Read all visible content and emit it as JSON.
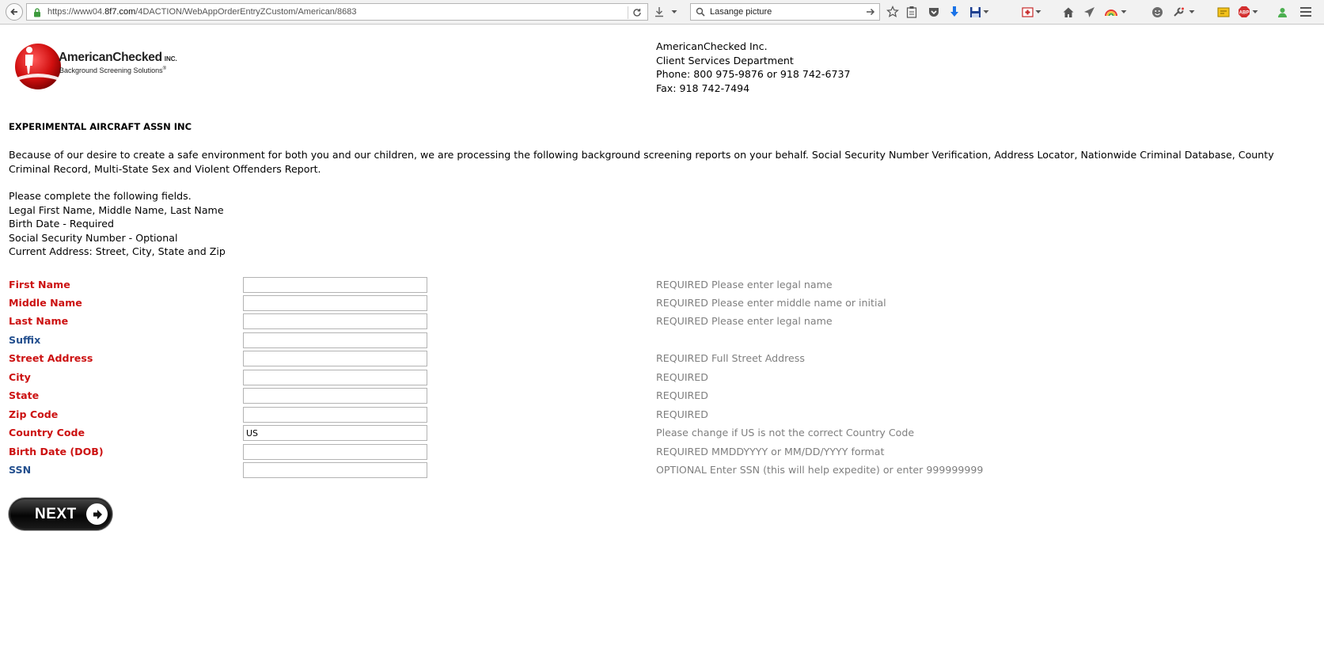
{
  "browser": {
    "url_prefix": "https://www04.",
    "url_host": "8f7.com",
    "url_path": "/4DACTION/WebAppOrderEntryZCustom/American/8683",
    "search_value": "Lasange picture",
    "colors": {
      "chrome_bg": "#f2f2f2",
      "download_arrow": "#1a73e8",
      "adblock": "#d32f2f"
    }
  },
  "logo": {
    "brand": "AmericanChecked",
    "brand_suffix": "INC.",
    "tagline": "Background Screening Solutions",
    "tagline_mark": "®"
  },
  "company": {
    "name": "AmericanChecked Inc.",
    "department": "Client Services Department",
    "phone": "Phone: 800 975-9876 or 918 742-6737",
    "fax": "Fax: 918 742-7494"
  },
  "org_name": "EXPERIMENTAL AIRCRAFT ASSN INC",
  "intro": "Because of our desire to create a safe environment for both you and our children, we are processing the following background screening reports on your behalf. Social Security Number Verification, Address Locator, Nationwide Criminal Database, County Criminal Record, Multi-State Sex and Violent Offenders Report.",
  "instructions": [
    "Please complete the following fields.",
    "Legal First Name, Middle Name, Last Name",
    "Birth Date - Required",
    "Social Security Number - Optional",
    "Current Address: Street, City, State and Zip"
  ],
  "form": {
    "fields": [
      {
        "label": "First Name",
        "required": true,
        "value": "",
        "hint": "REQUIRED Please enter legal name"
      },
      {
        "label": "Middle Name",
        "required": true,
        "value": "",
        "hint": "REQUIRED Please enter middle name or initial"
      },
      {
        "label": "Last Name",
        "required": true,
        "value": "",
        "hint": "REQUIRED Please enter legal name"
      },
      {
        "label": "Suffix",
        "required": false,
        "value": "",
        "hint": ""
      },
      {
        "label": "Street Address",
        "required": true,
        "value": "",
        "hint": "REQUIRED Full Street Address"
      },
      {
        "label": "City",
        "required": true,
        "value": "",
        "hint": "REQUIRED"
      },
      {
        "label": "State",
        "required": true,
        "value": "",
        "hint": "REQUIRED"
      },
      {
        "label": "Zip Code",
        "required": true,
        "value": "",
        "hint": "REQUIRED"
      },
      {
        "label": "Country Code",
        "required": true,
        "value": "US",
        "hint": "Please change if US is not the correct Country Code"
      },
      {
        "label": "Birth Date (DOB)",
        "required": true,
        "value": "",
        "hint": "REQUIRED MMDDYYYY or MM/DD/YYYY format"
      },
      {
        "label": "SSN",
        "required": false,
        "value": "",
        "hint": "OPTIONAL Enter SSN (this will help expedite) or enter 999999999"
      }
    ],
    "colors": {
      "required_label": "#cc1111",
      "optional_label": "#234f8e",
      "hint": "#7f7f7f"
    },
    "next_label": "NEXT"
  }
}
